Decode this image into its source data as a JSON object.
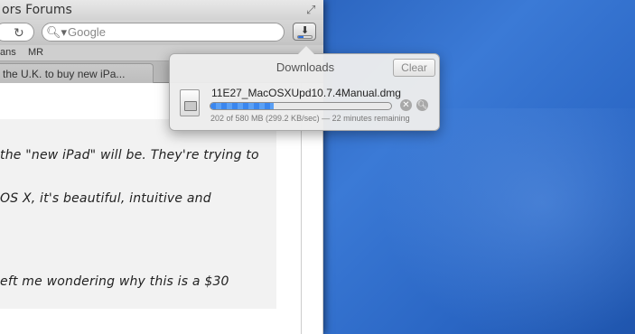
{
  "window": {
    "title": "ors Forums",
    "search_placeholder": "Google"
  },
  "bookmarks": [
    "ans",
    "MR"
  ],
  "tabs": [
    {
      "label": "the U.K. to buy new iPa..."
    }
  ],
  "post": {
    "lines": [
      "the \"new iPad\" will be. They're trying to",
      "OS X, it's beautiful, intuitive and",
      "eft me wondering why this is a $30"
    ]
  },
  "downloads": {
    "title": "Downloads",
    "clear_label": "Clear",
    "items": [
      {
        "file_name": "11E27_MacOSXUpd10.7.4Manual.dmg",
        "progress": 0.35,
        "status": "202 of 580 MB (299.2 KB/sec) — 22 minutes remaining"
      }
    ]
  },
  "colors": {
    "progress": "#3a86ee",
    "desktop": "#2a63bd"
  }
}
